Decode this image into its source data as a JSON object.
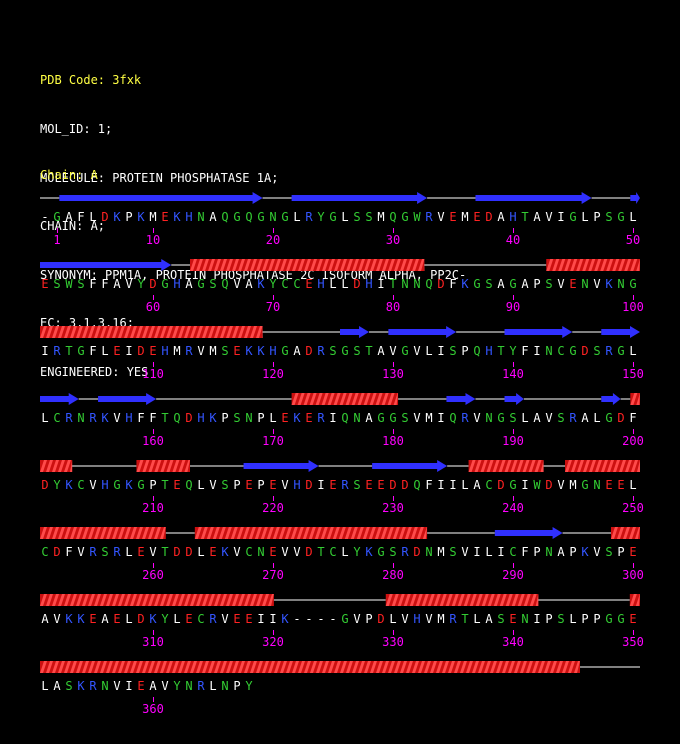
{
  "header": {
    "pdb_code": "PDB Code: 3fxk",
    "lines": [
      "MOL_ID: 1;",
      "MOLECULE: PROTEIN PHOSPHATASE 1A;",
      "CHAIN: A;",
      "SYNONYM: PPM1A, PROTEIN PHOSPHATASE 2C ISOFORM ALPHA, PP2C-",
      "EC: 3.1.3.16;",
      "ENGINEERED: YES"
    ],
    "chain_label": "Chain: A"
  },
  "colors": {
    "background": "#000000",
    "pdb_code": "#ffff44",
    "header_text": "#ffffff",
    "numbers": "#ff00ff",
    "strand": "#3030ff",
    "helix": "#ff3030",
    "coil": "#ffffff",
    "hydrophobic": "#ffffff",
    "polar": "#33cc33",
    "acidic": "#ff2222",
    "basic": "#3355ff",
    "gap": "#ffffff"
  },
  "sequence": {
    "rows": [
      {
        "residues": "-GAFLDKPKMEKHNAQGQGNGLRYGLSSMQGWRVEMEDAHTAVIGLPSGL",
        "numbers": [
          "1",
          "10",
          "20",
          "30",
          "40",
          "50"
        ],
        "ss": "--EEEEEEEEEEEEEEEEEEEEE---EEEEEEEEEEEEEE-----EEEEEEEEEEEE----E"
      },
      {
        "residues": "ESWSFFAVYDGHAGSQVAKYCCEHLLDHITNNQDFKGSAGAPSVENVKNG",
        "numbers": [
          "60",
          "70",
          "80",
          "90",
          "100"
        ],
        "ss": "EEEEEEEEEEEEEE--HHHHHHHHHHHHHHHHHHHHHHHHH-------------HHHHHHHHHH"
      },
      {
        "residues": "IRTGFLEIDEHMRVMSEKKHGADRSGSTAVGVLISPQHTYFINCGDSRGL",
        "numbers": [
          "110",
          "120",
          "130",
          "140",
          "150"
        ],
        "ss": "HHHHHHHHHHHHHHHHHHHHHHH--------EEE--EEEEEEE-----EEEEEEE---EEEE"
      },
      {
        "residues": "LCRNRKVHFFTQDHKPSNPLEKERIQNAGGSVMIQRVNGSLAVSRALGDF",
        "numbers": [
          "160",
          "170",
          "180",
          "190",
          "200"
        ],
        "ss": "EEEE--EEEEEE--------------HHHHHHHHHHH-----EEE---EE--------EE-H"
      },
      {
        "residues": "DYKCVHGKGPTEQLVSPEPEVHDIERSEEDDQFIILACDGIWDVMGNEEL",
        "numbers": [
          "210",
          "220",
          "230",
          "240",
          "250"
        ],
        "ss": "HHH------HHHHH-----EEEEEEE-----EEEEEEE--HHHHHHH--HHHHHHH"
      },
      {
        "residues": "CDFVRSRLEVTDDLEKVCNEVVDTCLYKGSRDNMSVILICFPNAPKVSPE",
        "numbers": [
          "260",
          "270",
          "280",
          "290",
          "300"
        ],
        "ss": "HHHHHHHHHHHHH---HHHHHHHHHHHHHHHHHHHHHHHH-------EEEEEEE-----HHH"
      },
      {
        "residues": "AVKKEAELDKYLECRVEEIIK----GVPDLVHVMRTLASENIPSLPPGGE",
        "numbers": [
          "310",
          "320",
          "330",
          "340",
          "350"
        ],
        "ss": "HHHHHHHHHHHHHHHHHHHHHHH-----------HHHHHHHHHHHHHHH---------H"
      },
      {
        "residues": "LASKRNVIEAVYNRLNPY",
        "numbers": [
          "360"
        ],
        "ss": "HHHHHHHHHHHHHHHHHH--"
      }
    ]
  }
}
